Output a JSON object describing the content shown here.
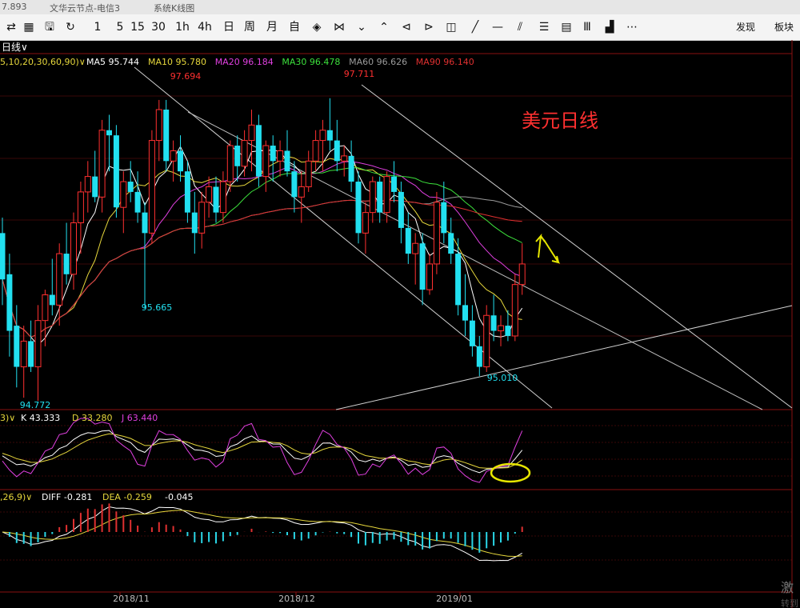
{
  "titlebar": {
    "price": "7.893",
    "server": "文华云节点-电信3",
    "chart_name": "系统K线图"
  },
  "toolbar": {
    "items": [
      {
        "label": "⇄",
        "icon": "swap-icon"
      },
      {
        "label": "▦",
        "icon": "layout-icon"
      },
      {
        "label": "🖫",
        "icon": "save-icon"
      },
      {
        "label": "↻",
        "icon": "refresh-icon"
      },
      {
        "label": "1"
      },
      {
        "label": "5"
      },
      {
        "label": "15"
      },
      {
        "label": "30"
      },
      {
        "label": "1h"
      },
      {
        "label": "4h"
      },
      {
        "label": "日"
      },
      {
        "label": "周"
      },
      {
        "label": "月"
      },
      {
        "label": "自"
      },
      {
        "label": "◈",
        "icon": "diamond-icon"
      },
      {
        "label": "⋈",
        "icon": "bowtie-icon"
      },
      {
        "label": "⌄",
        "icon": "chevron-down-icon"
      },
      {
        "label": "⌃",
        "icon": "chevron-up-icon"
      },
      {
        "label": "⊲",
        "icon": "left-arrow-icon"
      },
      {
        "label": "⊳",
        "icon": "right-arrow-icon"
      },
      {
        "label": "◫",
        "icon": "panel-icon"
      },
      {
        "label": "╱",
        "icon": "line-tool-icon"
      },
      {
        "label": "—",
        "icon": "hline-tool-icon"
      },
      {
        "label": "⫽",
        "icon": "parallel-tool-icon"
      },
      {
        "label": "☰",
        "icon": "menu-icon"
      },
      {
        "label": "▤",
        "icon": "list-icon"
      },
      {
        "label": "Ⅲ",
        "icon": "bars-icon"
      },
      {
        "label": "▟",
        "icon": "chart-icon"
      },
      {
        "label": "⋯",
        "icon": "more-icon"
      }
    ],
    "right": [
      "发现",
      "板块"
    ]
  },
  "chart_data": {
    "type": "candlestick",
    "title": "美元日线",
    "period_label": "日线",
    "ma_prefix": "5,10,20,30,60,90)",
    "ma_legend": [
      {
        "name": "MA5",
        "value": "95.744",
        "color": "#ffffff"
      },
      {
        "name": "MA10",
        "value": "95.780",
        "color": "#e6d73c"
      },
      {
        "name": "MA20",
        "value": "96.184",
        "color": "#e040e0"
      },
      {
        "name": "MA30",
        "value": "96.478",
        "color": "#3ce03c"
      },
      {
        "name": "MA60",
        "value": "96.626",
        "color": "#9a9a9a"
      },
      {
        "name": "MA90",
        "value": "96.140",
        "color": "#e03030"
      }
    ],
    "price_annotations": [
      "97.694",
      "97.711",
      "95.665",
      "94.772",
      "95.010"
    ],
    "x_labels": [
      "2018/11",
      "2018/12",
      "2019/01"
    ],
    "kdj": {
      "prefix": "3)",
      "k_label": "K 43.333",
      "d_label": "D 33.280",
      "j_label": "J 63.440",
      "colors": {
        "k": "#ffffff",
        "d": "#e6d73c",
        "j": "#e040e0"
      }
    },
    "macd": {
      "prefix": ",26,9)",
      "diff_label": "DIFF -0.281",
      "dea_label": "DEA -0.259",
      "macd_label": "-0.045",
      "colors": {
        "diff": "#ffffff",
        "dea": "#e6d73c",
        "pos": "#e03030",
        "neg": "#2ad6e6"
      }
    },
    "colors": {
      "up": "#ff3030",
      "down": "#22e0f0",
      "annotation": "#e6e600",
      "title": "#ff3030",
      "price_up": "#ff3030",
      "price_down": "#22e0f0"
    },
    "candles": [
      {
        "o": 96.4,
        "h": 96.55,
        "l": 95.7,
        "c": 95.95
      },
      {
        "o": 96.0,
        "h": 96.2,
        "l": 95.2,
        "c": 95.45
      },
      {
        "o": 95.5,
        "h": 95.7,
        "l": 94.9,
        "c": 95.1
      },
      {
        "o": 95.1,
        "h": 95.5,
        "l": 94.8,
        "c": 95.35
      },
      {
        "o": 95.35,
        "h": 95.55,
        "l": 95.05,
        "c": 95.1
      },
      {
        "o": 95.1,
        "h": 95.7,
        "l": 94.77,
        "c": 95.55
      },
      {
        "o": 95.55,
        "h": 95.85,
        "l": 95.3,
        "c": 95.8
      },
      {
        "o": 95.8,
        "h": 96.15,
        "l": 95.6,
        "c": 95.7
      },
      {
        "o": 95.7,
        "h": 96.3,
        "l": 95.5,
        "c": 96.2
      },
      {
        "o": 96.2,
        "h": 96.5,
        "l": 95.9,
        "c": 96.0
      },
      {
        "o": 96.0,
        "h": 96.6,
        "l": 95.85,
        "c": 96.5
      },
      {
        "o": 96.5,
        "h": 96.9,
        "l": 96.2,
        "c": 96.8
      },
      {
        "o": 96.8,
        "h": 97.1,
        "l": 96.6,
        "c": 96.95
      },
      {
        "o": 96.95,
        "h": 97.2,
        "l": 96.7,
        "c": 96.75
      },
      {
        "o": 96.75,
        "h": 97.5,
        "l": 96.6,
        "c": 97.4
      },
      {
        "o": 97.4,
        "h": 97.55,
        "l": 97.0,
        "c": 97.35
      },
      {
        "o": 97.35,
        "h": 97.45,
        "l": 96.55,
        "c": 96.65
      },
      {
        "o": 96.65,
        "h": 97.0,
        "l": 96.4,
        "c": 96.9
      },
      {
        "o": 96.9,
        "h": 97.1,
        "l": 96.7,
        "c": 96.8
      },
      {
        "o": 96.8,
        "h": 97.0,
        "l": 96.5,
        "c": 96.6
      },
      {
        "o": 96.6,
        "h": 96.7,
        "l": 95.665,
        "c": 96.4
      },
      {
        "o": 96.4,
        "h": 97.4,
        "l": 96.3,
        "c": 97.3
      },
      {
        "o": 97.3,
        "h": 97.694,
        "l": 97.1,
        "c": 97.6
      },
      {
        "o": 97.6,
        "h": 97.694,
        "l": 97.0,
        "c": 97.1
      },
      {
        "o": 97.1,
        "h": 97.3,
        "l": 96.9,
        "c": 97.2
      },
      {
        "o": 97.2,
        "h": 97.35,
        "l": 96.9,
        "c": 97.0
      },
      {
        "o": 97.0,
        "h": 97.1,
        "l": 96.5,
        "c": 96.6
      },
      {
        "o": 96.6,
        "h": 96.8,
        "l": 96.2,
        "c": 96.4
      },
      {
        "o": 96.4,
        "h": 96.8,
        "l": 96.25,
        "c": 96.7
      },
      {
        "o": 96.7,
        "h": 96.95,
        "l": 96.55,
        "c": 96.85
      },
      {
        "o": 96.85,
        "h": 96.95,
        "l": 96.5,
        "c": 96.6
      },
      {
        "o": 96.6,
        "h": 97.0,
        "l": 96.5,
        "c": 96.9
      },
      {
        "o": 96.9,
        "h": 97.3,
        "l": 96.8,
        "c": 97.25
      },
      {
        "o": 97.25,
        "h": 97.35,
        "l": 96.9,
        "c": 97.05
      },
      {
        "o": 97.05,
        "h": 97.4,
        "l": 96.95,
        "c": 97.3
      },
      {
        "o": 97.3,
        "h": 97.6,
        "l": 97.0,
        "c": 97.45
      },
      {
        "o": 97.45,
        "h": 97.55,
        "l": 96.85,
        "c": 96.95
      },
      {
        "o": 96.95,
        "h": 97.3,
        "l": 96.8,
        "c": 97.25
      },
      {
        "o": 97.25,
        "h": 97.35,
        "l": 96.9,
        "c": 97.1
      },
      {
        "o": 97.1,
        "h": 97.3,
        "l": 96.95,
        "c": 97.2
      },
      {
        "o": 97.2,
        "h": 97.4,
        "l": 96.95,
        "c": 97.0
      },
      {
        "o": 97.0,
        "h": 97.1,
        "l": 96.6,
        "c": 96.75
      },
      {
        "o": 96.75,
        "h": 97.0,
        "l": 96.5,
        "c": 96.85
      },
      {
        "o": 96.85,
        "h": 97.2,
        "l": 96.8,
        "c": 97.1
      },
      {
        "o": 97.1,
        "h": 97.4,
        "l": 97.0,
        "c": 97.3
      },
      {
        "o": 97.3,
        "h": 97.5,
        "l": 97.0,
        "c": 97.4
      },
      {
        "o": 97.4,
        "h": 97.711,
        "l": 97.2,
        "c": 97.3
      },
      {
        "o": 97.3,
        "h": 97.5,
        "l": 97.0,
        "c": 97.1
      },
      {
        "o": 97.1,
        "h": 97.25,
        "l": 96.95,
        "c": 97.15
      },
      {
        "o": 97.15,
        "h": 97.3,
        "l": 96.8,
        "c": 96.9
      },
      {
        "o": 96.9,
        "h": 97.0,
        "l": 96.3,
        "c": 96.4
      },
      {
        "o": 96.4,
        "h": 96.7,
        "l": 96.2,
        "c": 96.6
      },
      {
        "o": 96.6,
        "h": 96.95,
        "l": 96.5,
        "c": 96.9
      },
      {
        "o": 96.9,
        "h": 96.95,
        "l": 96.5,
        "c": 96.6
      },
      {
        "o": 96.6,
        "h": 97.0,
        "l": 96.5,
        "c": 96.95
      },
      {
        "o": 96.95,
        "h": 97.1,
        "l": 96.7,
        "c": 96.8
      },
      {
        "o": 96.8,
        "h": 96.9,
        "l": 96.3,
        "c": 96.45
      },
      {
        "o": 96.45,
        "h": 96.6,
        "l": 96.1,
        "c": 96.2
      },
      {
        "o": 96.2,
        "h": 96.4,
        "l": 95.9,
        "c": 96.3
      },
      {
        "o": 96.3,
        "h": 96.4,
        "l": 95.7,
        "c": 95.85
      },
      {
        "o": 95.85,
        "h": 96.2,
        "l": 95.8,
        "c": 96.1
      },
      {
        "o": 96.1,
        "h": 96.8,
        "l": 96.0,
        "c": 96.7
      },
      {
        "o": 96.7,
        "h": 96.9,
        "l": 96.3,
        "c": 96.4
      },
      {
        "o": 96.4,
        "h": 96.55,
        "l": 96.1,
        "c": 96.2
      },
      {
        "o": 96.2,
        "h": 96.35,
        "l": 95.6,
        "c": 95.7
      },
      {
        "o": 95.7,
        "h": 96.0,
        "l": 95.4,
        "c": 95.55
      },
      {
        "o": 95.55,
        "h": 95.7,
        "l": 95.2,
        "c": 95.3
      },
      {
        "o": 95.3,
        "h": 95.4,
        "l": 95.01,
        "c": 95.1
      },
      {
        "o": 95.1,
        "h": 95.7,
        "l": 95.05,
        "c": 95.6
      },
      {
        "o": 95.6,
        "h": 95.8,
        "l": 95.35,
        "c": 95.45
      },
      {
        "o": 95.45,
        "h": 95.6,
        "l": 95.3,
        "c": 95.5
      },
      {
        "o": 95.5,
        "h": 95.65,
        "l": 95.35,
        "c": 95.4
      },
      {
        "o": 95.4,
        "h": 96.0,
        "l": 95.35,
        "c": 95.9
      },
      {
        "o": 95.9,
        "h": 96.3,
        "l": 95.8,
        "c": 96.1
      }
    ],
    "ylim": [
      94.7,
      97.95
    ]
  },
  "right_edge": {
    "label1": "激",
    "label2": "转到"
  }
}
